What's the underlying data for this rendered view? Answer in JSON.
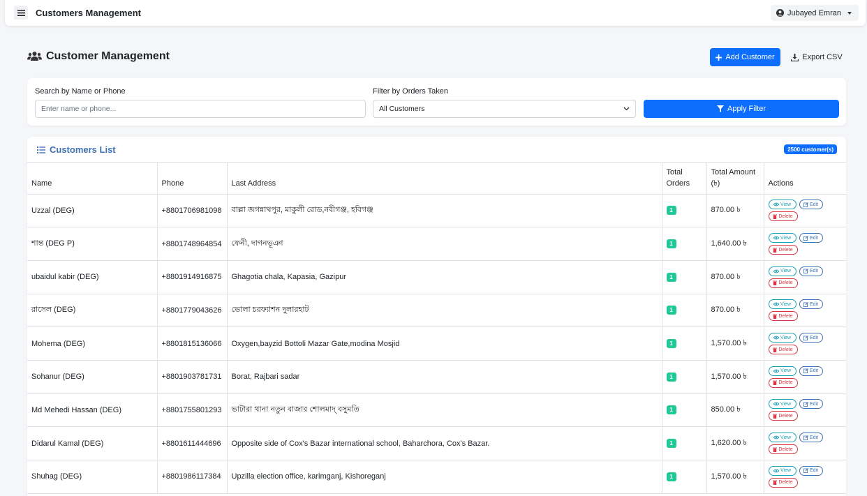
{
  "app": {
    "title": "Customers Management",
    "user_name": "Jubayed Emran"
  },
  "page": {
    "title": "Customer Management",
    "add_label": "Add Customer",
    "export_label": "Export CSV"
  },
  "filters": {
    "search_label": "Search by Name or Phone",
    "search_placeholder": "Enter name or phone...",
    "search_value": "",
    "orders_label": "Filter by Orders Taken",
    "orders_selected": "All Customers",
    "apply_label": "Apply Filter"
  },
  "list": {
    "title": "Customers List",
    "count_badge": "2500 customer(s)",
    "columns": {
      "name": "Name",
      "phone": "Phone",
      "address": "Last Address",
      "orders": "Total Orders",
      "amount": "Total Amount (৳)",
      "actions": "Actions"
    },
    "action_labels": {
      "view": "View",
      "edit": "Edit",
      "delete": "Delete"
    },
    "rows": [
      {
        "name": "Uzzal (DEG)",
        "phone": "+8801706981098",
        "address": "বাল্লা জগন্নাথপুর, মাকুলী রোড,নবীগঞ্জ, হবিগঞ্জ",
        "orders": "1",
        "amount": "870.00 ৳"
      },
      {
        "name": "শান্ত (DEG P)",
        "phone": "+8801748964854",
        "address": "ফেনী, দাগনভূঞা",
        "orders": "1",
        "amount": "1,640.00 ৳"
      },
      {
        "name": "ubaidul kabir (DEG)",
        "phone": "+8801914916875",
        "address": "Ghagotia chala, Kapasia, Gazipur",
        "orders": "1",
        "amount": "870.00 ৳"
      },
      {
        "name": "রাসেল (DEG)",
        "phone": "+8801779043626",
        "address": "ভোলা চরফ্যাশন দুলারহাট",
        "orders": "1",
        "amount": "870.00 ৳"
      },
      {
        "name": "Mohema (DEG)",
        "phone": "+8801815136066",
        "address": "Oxygen,bayzid Bottoli Mazar Gate,modina Mosjid",
        "orders": "1",
        "amount": "1,570.00 ৳"
      },
      {
        "name": "Sohanur (DEG)",
        "phone": "+8801903781731",
        "address": "Borat, Rajbari sadar",
        "orders": "1",
        "amount": "1,570.00 ৳"
      },
      {
        "name": "Md Mehedi Hassan (DEG)",
        "phone": "+8801755801293",
        "address": "ভাটারা থানা নতুন বাজার শোলমাদ্ বসুমতি",
        "orders": "1",
        "amount": "850.00 ৳"
      },
      {
        "name": "Didarul Kamal (DEG)",
        "phone": "+8801611444696",
        "address": "Opposite side of Cox's Bazar international school, Baharchora, Cox's Bazar.",
        "orders": "1",
        "amount": "1,620.00 ৳"
      },
      {
        "name": "Shuhag (DEG)",
        "phone": "+8801986117384",
        "address": "Upzilla election office, karimganj, Kishoreganj",
        "orders": "1",
        "amount": "1,570.00 ৳"
      }
    ]
  }
}
